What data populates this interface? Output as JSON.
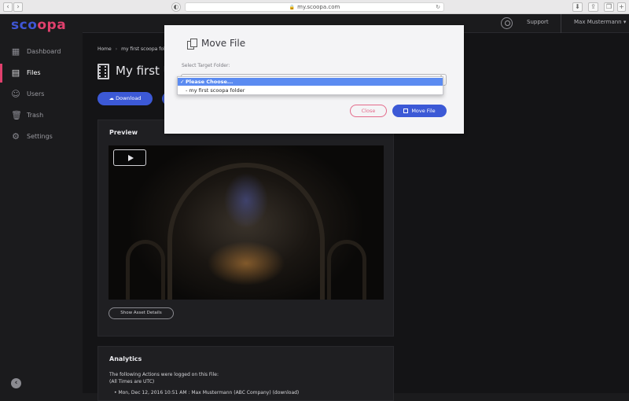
{
  "browser": {
    "url": "my.scoopa.com"
  },
  "sidebar": {
    "logo_main": "sco",
    "logo_accent": "opa",
    "items": [
      {
        "label": "Dashboard",
        "icon": "dashboard-icon",
        "active": false
      },
      {
        "label": "Files",
        "icon": "file-icon",
        "active": true
      },
      {
        "label": "Users",
        "icon": "user-icon",
        "active": false
      },
      {
        "label": "Trash",
        "icon": "trash-icon",
        "active": false
      },
      {
        "label": "Settings",
        "icon": "gear-icon",
        "active": false
      }
    ]
  },
  "header": {
    "support": "Support",
    "user": "Max Mustermann ▾"
  },
  "main": {
    "breadcrumb": {
      "home": "Home",
      "folder": "my first scoopa fol"
    },
    "title": "My first U",
    "download_label": "Download",
    "preview": {
      "title": "Preview",
      "details_button": "Show Asset Details"
    },
    "analytics": {
      "title": "Analytics",
      "line1": "The following Actions were logged on this File:",
      "line2": "(All Times are UTC)",
      "entry": "Mon, Dec 12, 2016 10:51 AM : Max Mustermann (ABC Company) (download)"
    }
  },
  "modal": {
    "title": "Move File",
    "target_label": "Select Target Folder:",
    "options": [
      {
        "label": "Please Choose...",
        "selected": true
      },
      {
        "label": "- my first scoopa folder",
        "selected": false
      }
    ],
    "close_label": "Close",
    "move_label": "Move File"
  },
  "colors": {
    "accent_blue": "#3c59d6",
    "accent_pink": "#e0406d",
    "sidebar_bg": "#1b1b1d",
    "modal_bg": "#f4f4f6"
  }
}
